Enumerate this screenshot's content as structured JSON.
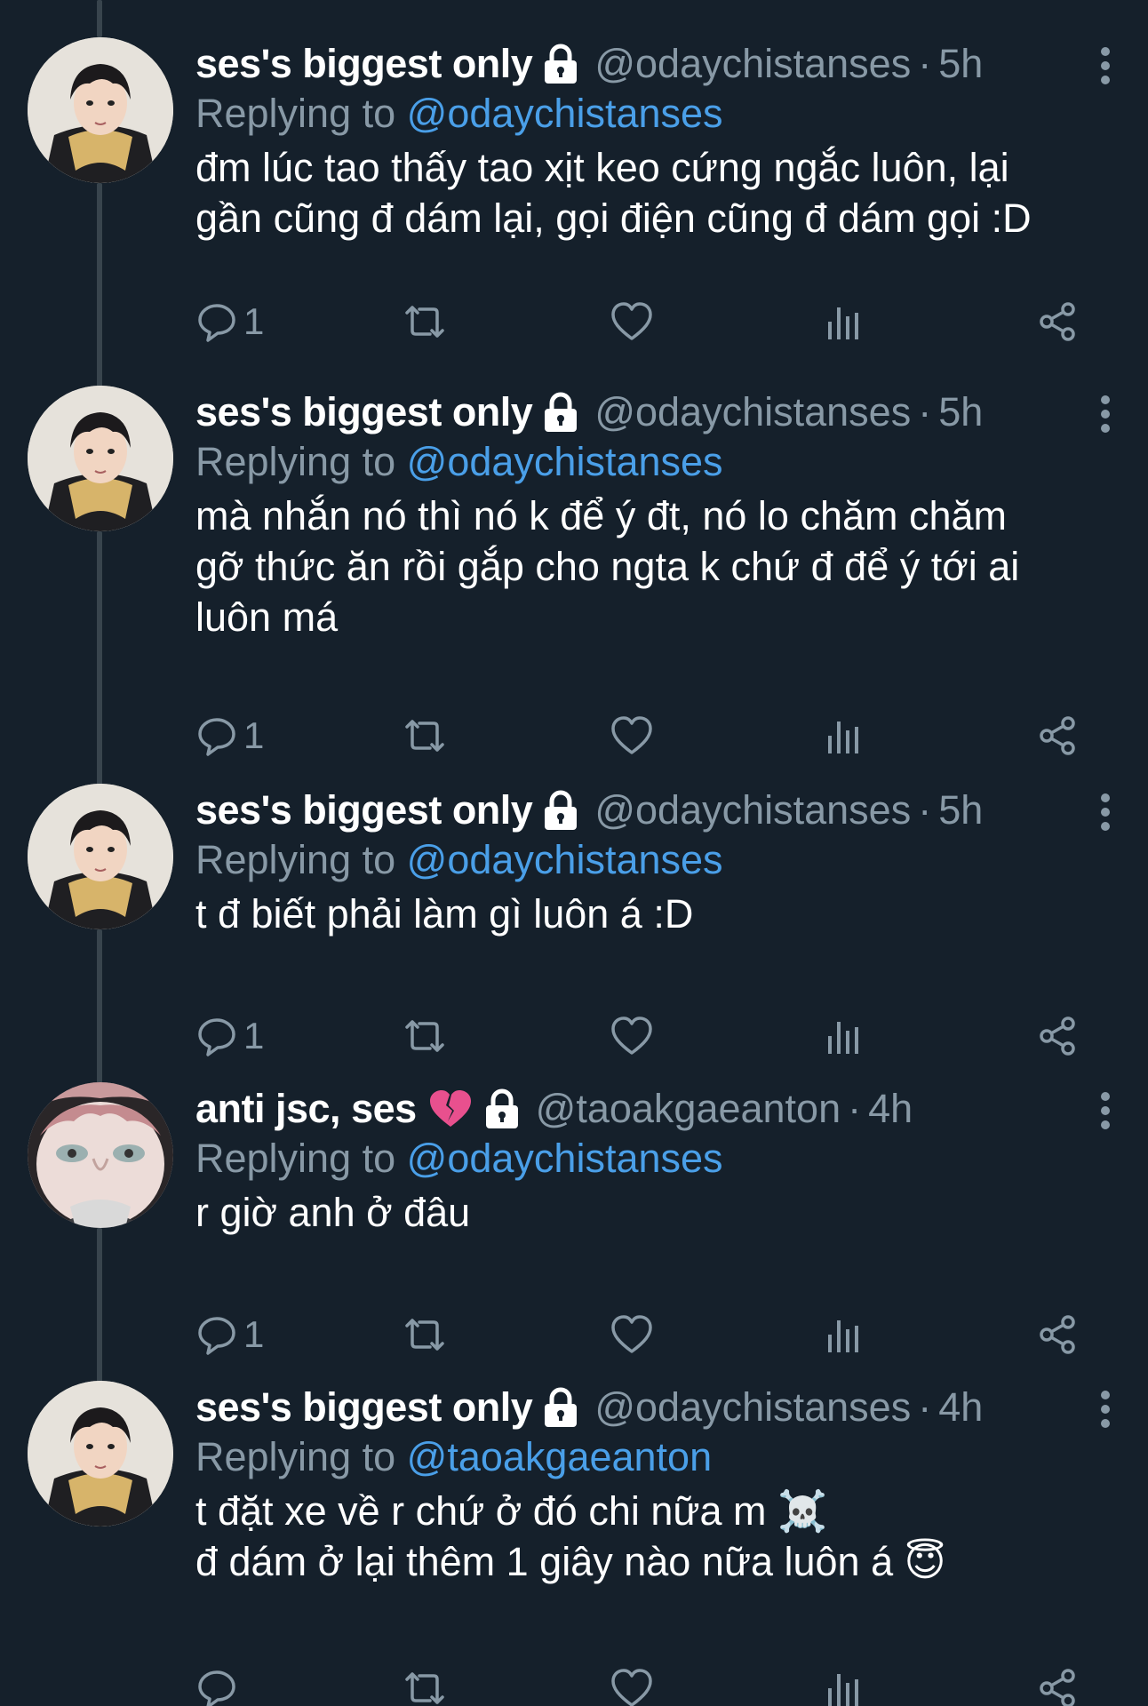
{
  "colors": {
    "background": "#15202b",
    "text_primary": "#ffffff",
    "text_secondary": "#8899a6",
    "mention": "#4a9fe8",
    "thread_line": "#38444d"
  },
  "tweets": [
    {
      "display_name": "ses's biggest only",
      "emoji": "",
      "handle": "@odaychistanses",
      "separator": "·",
      "time": "5h",
      "replying_label": "Replying to",
      "replying_to": "@odaychistanses",
      "lines": [
        "đm lúc tao thấy tao xịt keo cứng ngắc luôn, lại",
        "gần cũng đ dám lại, gọi điện cũng đ dám gọi :D"
      ],
      "reply_count": "1",
      "avatar": "avatar-boy-icon"
    },
    {
      "display_name": "ses's biggest only",
      "emoji": "",
      "handle": "@odaychistanses",
      "separator": "·",
      "time": "5h",
      "replying_label": "Replying to",
      "replying_to": "@odaychistanses",
      "lines": [
        "mà nhắn nó thì nó k để ý đt, nó lo chăm chăm",
        "gỡ thức ăn rồi gắp cho ngta k chứ đ để ý tới ai",
        "luôn má"
      ],
      "reply_count": "1",
      "avatar": "avatar-boy-icon"
    },
    {
      "display_name": "ses's biggest only",
      "emoji": "",
      "handle": "@odaychistanses",
      "separator": "·",
      "time": "5h",
      "replying_label": "Replying to",
      "replying_to": "@odaychistanses",
      "lines": [
        "t đ biết phải làm gì luôn á :D"
      ],
      "reply_count": "1",
      "avatar": "avatar-boy-icon"
    },
    {
      "display_name": "anti jsc, ses",
      "emoji": "broken-heart-icon",
      "handle": "@taoakgaeanton",
      "separator": "·",
      "time": "4h",
      "replying_label": "Replying to",
      "replying_to": "@odaychistanses",
      "lines": [
        "r giờ anh ở đâu"
      ],
      "reply_count": "1",
      "avatar": "avatar-closeup-icon"
    },
    {
      "display_name": "ses's biggest only",
      "emoji": "",
      "handle": "@odaychistanses",
      "separator": "·",
      "time": "4h",
      "replying_label": "Replying to",
      "replying_to": "@taoakgaeanton",
      "lines": [
        "t đặt xe về r chứ ở đó chi nữa m ☠️",
        "đ dám ở lại thêm 1 giây nào nữa luôn á 😇"
      ],
      "reply_count": "",
      "avatar": "avatar-boy-icon"
    }
  ]
}
